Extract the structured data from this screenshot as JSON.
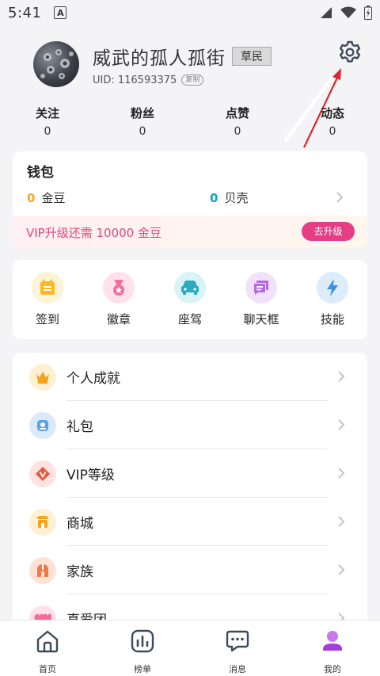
{
  "status_bar": {
    "time": "5:41",
    "notification_icon_letter": "A"
  },
  "profile": {
    "username": "威武的孤人孤街",
    "rank_badge": "草民",
    "uid": "UID: 116593375",
    "copy_label": "复制"
  },
  "stats": [
    {
      "label": "关注",
      "value": "0"
    },
    {
      "label": "粉丝",
      "value": "0"
    },
    {
      "label": "点赞",
      "value": "0"
    },
    {
      "label": "动态",
      "value": "0"
    }
  ],
  "wallet": {
    "title": "钱包",
    "gold_count": "0",
    "gold_label": "金豆",
    "shell_count": "0",
    "shell_label": "贝壳",
    "vip_text": "VIP升级还需 10000 金豆",
    "upgrade_button": "去升级"
  },
  "features": [
    {
      "label": "签到",
      "icon": "calendar-icon"
    },
    {
      "label": "徽章",
      "icon": "medal-icon"
    },
    {
      "label": "座驾",
      "icon": "car-icon"
    },
    {
      "label": "聊天框",
      "icon": "chat-frame-icon"
    },
    {
      "label": "技能",
      "icon": "lightning-icon"
    }
  ],
  "menu": [
    {
      "label": "个人成就",
      "icon": "crown-icon"
    },
    {
      "label": "礼包",
      "icon": "gift-pack-icon"
    },
    {
      "label": "VIP等级",
      "icon": "vip-level-icon"
    },
    {
      "label": "商城",
      "icon": "shop-icon"
    },
    {
      "label": "家族",
      "icon": "family-helmet-icon"
    },
    {
      "label": "真爱团",
      "icon": "love-group-icon"
    }
  ],
  "bottom_nav": [
    {
      "label": "首页",
      "icon": "home-icon"
    },
    {
      "label": "榜单",
      "icon": "ranking-icon"
    },
    {
      "label": "消息",
      "icon": "message-icon"
    },
    {
      "label": "我的",
      "icon": "profile-icon"
    }
  ],
  "colors": {
    "accent_pink": "#e53d86",
    "gold": "#f5a623",
    "shell_blue": "#1a9cc9",
    "annotation_arrow": "#e0262d"
  }
}
